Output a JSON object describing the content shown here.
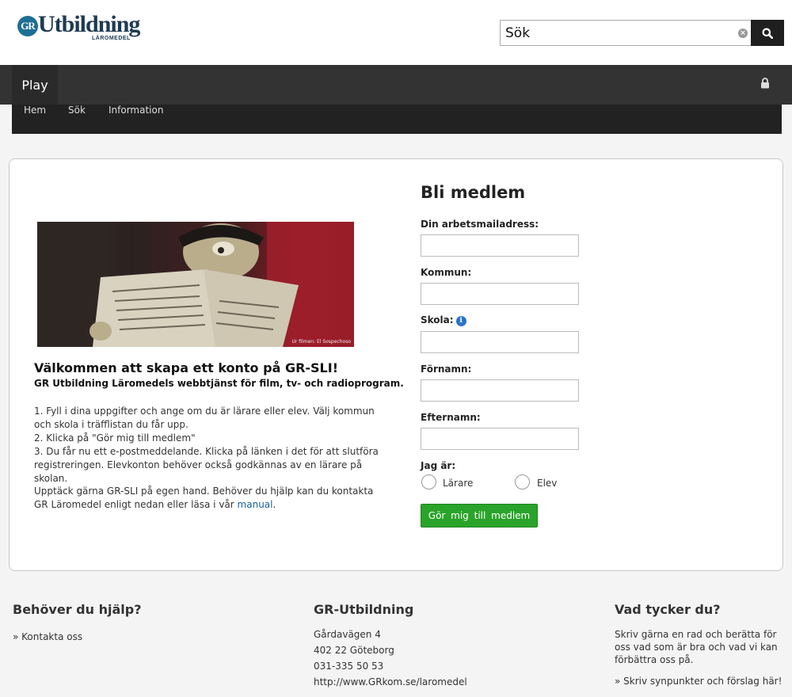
{
  "header": {
    "logo": {
      "mark": "GR",
      "name": "Utbildning",
      "sub": "LÄROMEDEL"
    },
    "search": {
      "value": "Sök",
      "placeholder": "Sök",
      "clear_icon": "clear-icon",
      "button_icon": "search-icon"
    }
  },
  "nav": {
    "brand": "Play",
    "lock_icon": "lock-icon",
    "items": [
      {
        "label": "Hem"
      },
      {
        "label": "Sök"
      },
      {
        "label": "Information"
      }
    ]
  },
  "intro": {
    "image_credit": "Ur filmen: El Sospechoso",
    "title": "Välkommen att skapa ett konto på GR-SLI!",
    "subtitle": "GR Utbildning Läromedels webbtjänst för film, tv- och radioprogram.",
    "steps": [
      "1. Fyll i dina uppgifter och ange om du är lärare eller elev. Välj kommun och skola i träfflistan du får upp.",
      "2. Klicka på \"Gör mig till medlem\"",
      "3. Du får nu ett e-postmeddelande. Klicka på länken i det för att slutföra registreringen. Elevkonton behöver också godkännas av en lärare på skolan."
    ],
    "explore_text": "Upptäck gärna GR-SLI på egen hand. Behöver du hjälp kan du kontakta GR Läromedel enligt nedan eller läsa i vår ",
    "explore_link": "manual",
    "explore_end": "."
  },
  "form": {
    "title": "Bli medlem",
    "email_label": "Din arbetsmailadress:",
    "email_value": "",
    "municipality_label": "Kommun:",
    "municipality_value": "",
    "school_label": "Skola:",
    "school_info_icon": "info-icon",
    "school_value": "",
    "firstname_label": "Förnamn:",
    "firstname_value": "",
    "lastname_label": "Efternamn:",
    "lastname_value": "",
    "role_label": "Jag är:",
    "role_options": [
      "Lärare",
      "Elev"
    ],
    "submit_label": "Gör mig till medlem"
  },
  "footer": {
    "help": {
      "title": "Behöver du hjälp?",
      "link": "» Kontakta oss"
    },
    "org": {
      "title": "GR-Utbildning",
      "lines": [
        "Gårdavägen 4",
        "402 22 Göteborg",
        "031-335 50 53",
        "http://www.GRkom.se/laromedel"
      ]
    },
    "feedback": {
      "title": "Vad tycker du?",
      "text": "Skriv gärna en rad och berätta för oss vad som är bra och vad vi kan förbättra oss på.",
      "link": "» Skriv synpunkter och förslag här!"
    }
  },
  "colors": {
    "nav_bg": "#333333",
    "subnav_bg": "#222222",
    "accent_green": "#2aa32a",
    "link_blue": "#1a5fa8"
  }
}
